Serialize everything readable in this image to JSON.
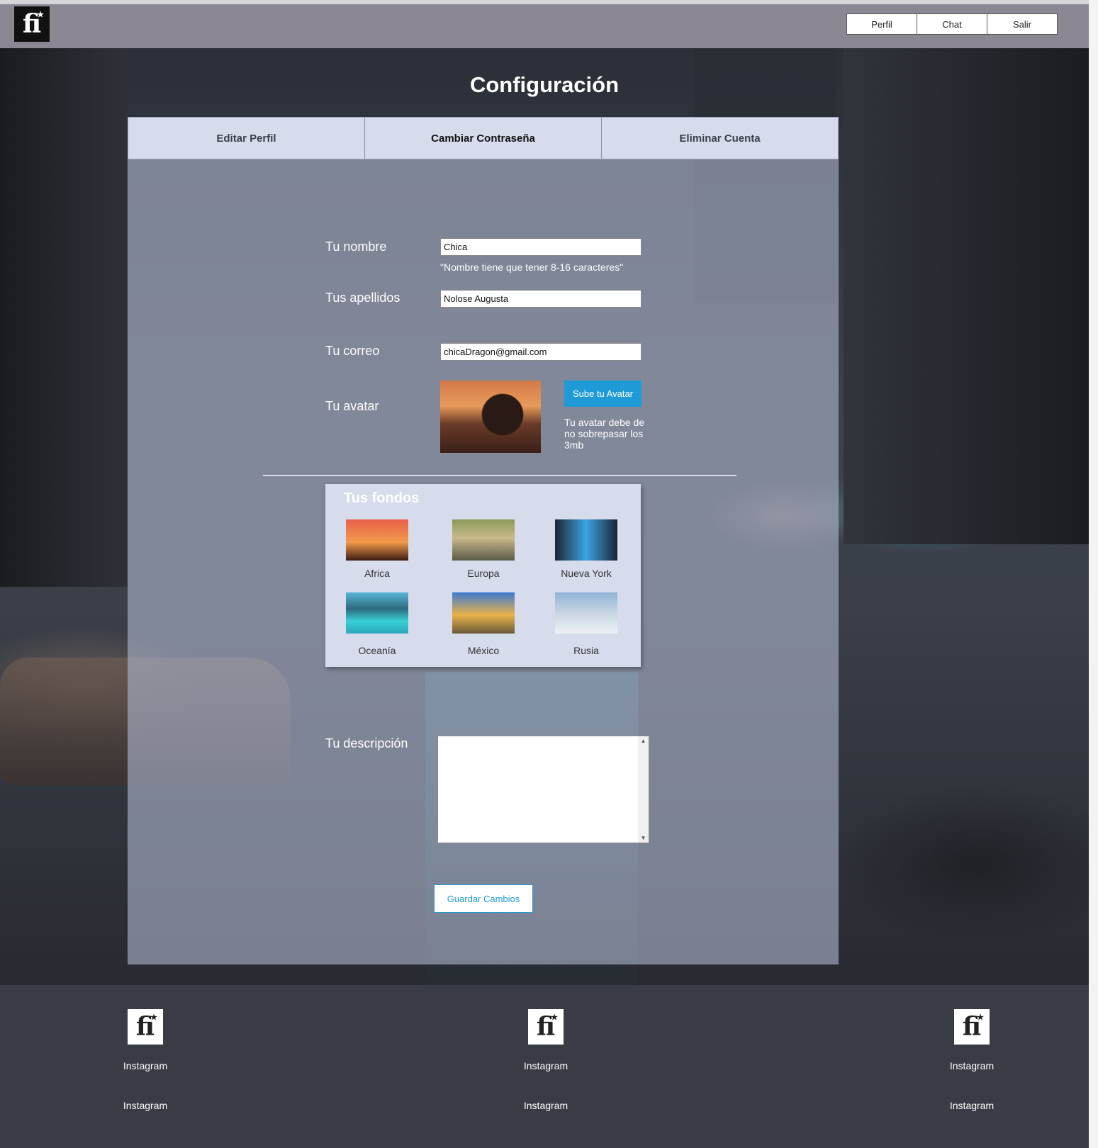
{
  "app": {
    "logo_text": "fi"
  },
  "nav": {
    "items": [
      "Perfil",
      "Chat",
      "Salir"
    ]
  },
  "page": {
    "title": "Configuración"
  },
  "tabs": [
    {
      "label": "Editar Perfil"
    },
    {
      "label": "Cambiar Contraseña",
      "active": true
    },
    {
      "label": "Eliminar Cuenta"
    }
  ],
  "form": {
    "name": {
      "label": "Tu nombre",
      "value": "Chica",
      "hint": "\"Nombre tiene que tener 8-16 caracteres\""
    },
    "surname": {
      "label": "Tus apellidos",
      "value": "Nolose Augusta"
    },
    "email": {
      "label": "Tu correo",
      "value": "chicaDragon@gmail.com"
    },
    "avatar": {
      "label": "Tu avatar",
      "upload_label": "Sube tu Avatar",
      "note": "Tu avatar debe de no sobrepasar los 3mb"
    },
    "backgrounds": {
      "title": "Tus fondos",
      "items": [
        "Africa",
        "Europa",
        "Nueva York",
        "Oceanía",
        "México",
        "Rusia"
      ]
    },
    "description": {
      "label": "Tu descripción",
      "value": ""
    },
    "save_label": "Guardar Cambios"
  },
  "footer": {
    "columns": [
      {
        "links": [
          "Instagram",
          "Instagram"
        ]
      },
      {
        "links": [
          "Instagram",
          "Instagram"
        ]
      },
      {
        "links": [
          "Instagram",
          "Instagram"
        ]
      }
    ]
  },
  "colors": {
    "topbar": "#8b8894",
    "tab_bg": "#d6dcec",
    "accent": "#1e9bd7",
    "footer": "#393c45"
  }
}
